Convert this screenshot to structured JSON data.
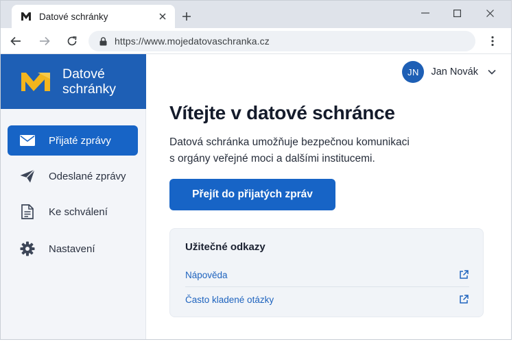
{
  "browser": {
    "tab_title": "Datové schránky",
    "url": "https://www.mojedatovaschranka.cz"
  },
  "brand": {
    "line1": "Datové",
    "line2": "schránky",
    "accent_color": "#f2b51e",
    "header_color": "#1e5fb5"
  },
  "sidebar": {
    "items": [
      {
        "label": "Přijaté zprávy",
        "icon": "envelope-icon",
        "active": true
      },
      {
        "label": "Odeslané zprávy",
        "icon": "paper-plane-icon",
        "active": false
      },
      {
        "label": "Ke schválení",
        "icon": "document-icon",
        "active": false
      },
      {
        "label": "Nastavení",
        "icon": "gear-icon",
        "active": false
      }
    ]
  },
  "user": {
    "initials": "JN",
    "name": "Jan Novák"
  },
  "main": {
    "heading": "Vítejte v datové schránce",
    "lead_line1": "Datová schránka umožňuje bezpečnou komunikaci",
    "lead_line2": "s orgány veřejné moci a dalšími institucemi.",
    "cta_label": "Přejít do přijatých zpráv",
    "primary_color": "#1764c6"
  },
  "links": {
    "title": "Užitečné odkazy",
    "items": [
      {
        "label": "Nápověda",
        "icon": "external-link-icon"
      },
      {
        "label": "Často kladené otázky",
        "icon": "external-link-icon"
      }
    ]
  }
}
